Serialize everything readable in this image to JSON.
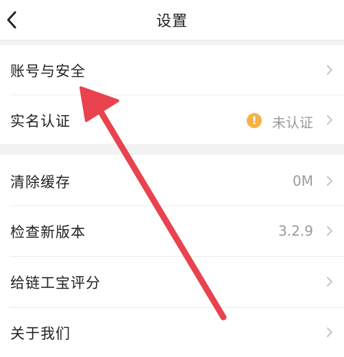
{
  "header": {
    "title": "设置",
    "back_icon": "chevron-left-icon"
  },
  "group1": {
    "items": [
      {
        "label": "账号与安全",
        "value": ""
      },
      {
        "label": "实名认证",
        "value": "未认证",
        "status_icon": "warning-icon",
        "status_color": "#f4b445"
      }
    ]
  },
  "group2": {
    "items": [
      {
        "label": "清除缓存",
        "value": "0M"
      },
      {
        "label": "检查新版本",
        "value": "3.2.9"
      },
      {
        "label": "给链工宝评分",
        "value": ""
      },
      {
        "label": "关于我们",
        "value": ""
      }
    ]
  },
  "annotation": {
    "color": "#e8434f",
    "icon": "red-arrow-icon"
  }
}
